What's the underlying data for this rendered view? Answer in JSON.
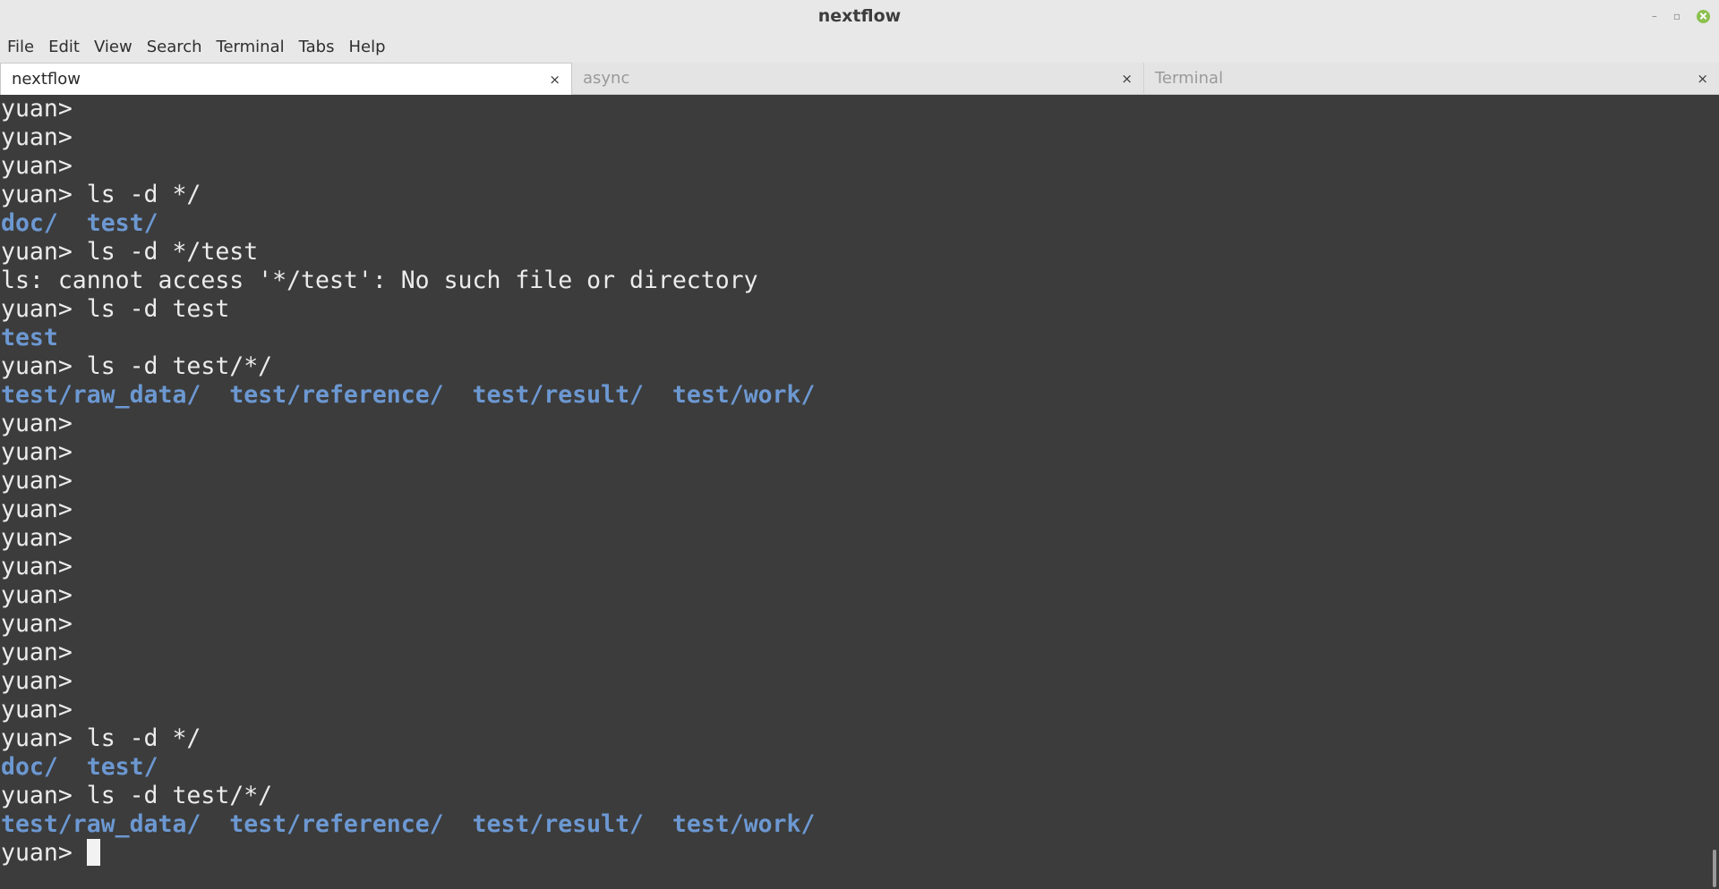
{
  "window": {
    "title": "nextflow",
    "controls": {
      "minimize": "–",
      "maximize": "▫"
    }
  },
  "menu": [
    "File",
    "Edit",
    "View",
    "Search",
    "Terminal",
    "Tabs",
    "Help"
  ],
  "tabs": [
    {
      "label": "nextflow",
      "active": true,
      "close": "×"
    },
    {
      "label": "async",
      "active": false,
      "close": "×"
    },
    {
      "label": "Terminal",
      "active": false,
      "close": "×"
    }
  ],
  "terminal": {
    "prompt": "yuan> ",
    "lines": [
      {
        "type": "prompt",
        "command": ""
      },
      {
        "type": "prompt",
        "command": ""
      },
      {
        "type": "prompt",
        "command": ""
      },
      {
        "type": "prompt",
        "command": "ls -d */"
      },
      {
        "type": "dirs",
        "items": [
          "doc/",
          "test/"
        ]
      },
      {
        "type": "prompt",
        "command": "ls -d */test"
      },
      {
        "type": "output",
        "text": "ls: cannot access '*/test': No such file or directory"
      },
      {
        "type": "prompt",
        "command": "ls -d test"
      },
      {
        "type": "dirs",
        "items": [
          "test"
        ]
      },
      {
        "type": "prompt",
        "command": "ls -d test/*/"
      },
      {
        "type": "dirs",
        "items": [
          "test/raw_data/",
          "test/reference/",
          "test/result/",
          "test/work/"
        ]
      },
      {
        "type": "prompt",
        "command": ""
      },
      {
        "type": "prompt",
        "command": ""
      },
      {
        "type": "prompt",
        "command": ""
      },
      {
        "type": "prompt",
        "command": ""
      },
      {
        "type": "prompt",
        "command": ""
      },
      {
        "type": "prompt",
        "command": ""
      },
      {
        "type": "prompt",
        "command": ""
      },
      {
        "type": "prompt",
        "command": ""
      },
      {
        "type": "prompt",
        "command": ""
      },
      {
        "type": "prompt",
        "command": ""
      },
      {
        "type": "prompt",
        "command": ""
      },
      {
        "type": "prompt",
        "command": "ls -d */"
      },
      {
        "type": "dirs",
        "items": [
          "doc/",
          "test/"
        ]
      },
      {
        "type": "prompt",
        "command": "ls -d test/*/"
      },
      {
        "type": "dirs",
        "items": [
          "test/raw_data/",
          "test/reference/",
          "test/result/",
          "test/work/"
        ]
      },
      {
        "type": "prompt",
        "command": "",
        "cursor": true
      }
    ]
  },
  "colors": {
    "background": "#3c3c3c",
    "foreground": "#ececec",
    "directory": "#6c98d2",
    "close_button": "#8cc04f"
  }
}
